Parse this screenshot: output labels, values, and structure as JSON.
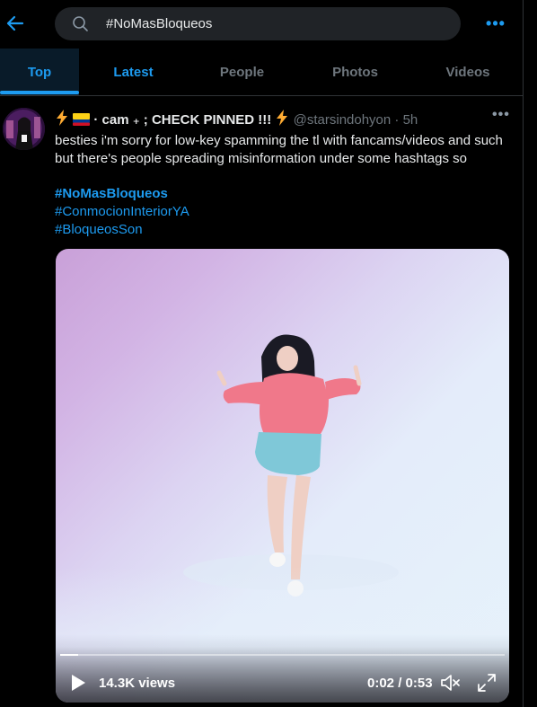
{
  "header": {
    "search_value": "#NoMasBloqueos",
    "more_label": "•••"
  },
  "tabs": [
    {
      "label": "Top",
      "selected": true
    },
    {
      "label": "Latest",
      "selected": false
    },
    {
      "label": "People",
      "selected": false
    },
    {
      "label": "Photos",
      "selected": false
    },
    {
      "label": "Videos",
      "selected": false
    }
  ],
  "tweet": {
    "display_name": "· cam ₊ ; CHECK PINNED !!!",
    "handle": "@starsindohyon",
    "separator": "·",
    "time": "5h",
    "more_label": "•••",
    "text": "besties i'm sorry for low-key spamming the tl with fancams/videos and such but there's people spreading misinformation under some hashtags so",
    "hashtags": [
      "#NoMasBloqueos",
      "#ConmocionInteriorYA",
      "#BloqueosSon"
    ],
    "video": {
      "views": "14.3K views",
      "time": "0:02 / 0:53",
      "progress": 0.04
    }
  },
  "colors": {
    "accent": "#1d9bf0",
    "background": "#000000",
    "muted": "#6e767d"
  }
}
